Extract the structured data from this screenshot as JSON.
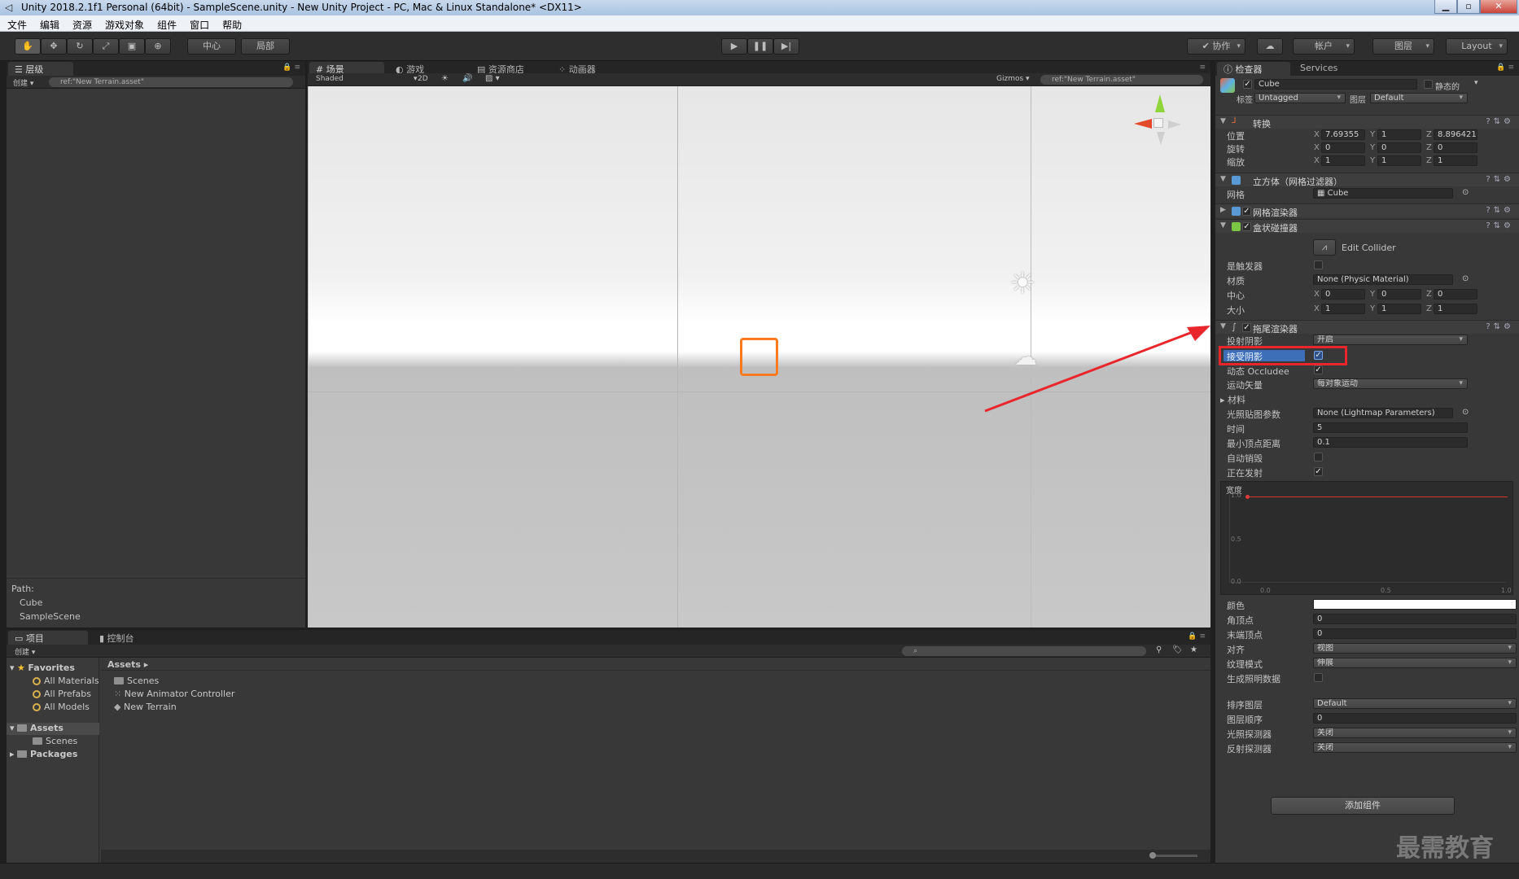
{
  "window": {
    "title": "Unity 2018.2.1f1 Personal (64bit) - SampleScene.unity - New Unity Project - PC, Mac & Linux Standalone* <DX11>"
  },
  "menu": [
    "文件",
    "编辑",
    "资源",
    "游戏对象",
    "组件",
    "窗口",
    "帮助"
  ],
  "toolbar": {
    "pivot": "中心",
    "local": "局部",
    "collab": "协作",
    "account": "帐户",
    "layers": "图层",
    "layout": "Layout"
  },
  "hierarchy": {
    "tab": "层级",
    "create": "创建",
    "search": "ref:\"New Terrain.asset\"",
    "path_label": "Path:",
    "path": [
      "Cube",
      "SampleScene"
    ]
  },
  "scene": {
    "tabs": [
      "场景",
      "游戏",
      "资源商店",
      "动画器"
    ],
    "shading": "Shaded",
    "mode2d": "2D",
    "gizmos": "Gizmos",
    "search": "ref:\"New Terrain.asset\""
  },
  "project": {
    "tabs": [
      "项目",
      "控制台"
    ],
    "create": "创建",
    "favorites": {
      "label": "Favorites",
      "items": [
        "All Materials",
        "All Prefabs",
        "All Models"
      ]
    },
    "assets_tree": {
      "label": "Assets",
      "children": [
        "Scenes"
      ]
    },
    "packages": "Packages",
    "breadcrumb": "Assets",
    "files": [
      "Scenes",
      "New Animator Controller",
      "New Terrain"
    ]
  },
  "inspector": {
    "tabs": [
      "检查器",
      "Services"
    ],
    "object_name": "Cube",
    "static_label": "静态的",
    "tag_label": "标签",
    "tag": "Untagged",
    "layer_label": "图层",
    "layer": "Default",
    "transform": {
      "title": "转换",
      "position_label": "位置",
      "position": [
        "7.69355",
        "1",
        "8.896421"
      ],
      "rotation_label": "旋转",
      "rotation": [
        "0",
        "0",
        "0"
      ],
      "scale_label": "缩放",
      "scale": [
        "1",
        "1",
        "1"
      ]
    },
    "meshfilter": {
      "title": "立方体（网格过滤器）",
      "mesh_label": "网格",
      "mesh": "Cube"
    },
    "meshrenderer": {
      "title": "网格渲染器"
    },
    "boxcollider": {
      "title": "盒状碰撞器",
      "edit": "Edit Collider",
      "trigger_label": "是触发器",
      "material_label": "材质",
      "material": "None (Physic Material)",
      "center_label": "中心",
      "center": [
        "0",
        "0",
        "0"
      ],
      "size_label": "大小",
      "size": [
        "1",
        "1",
        "1"
      ]
    },
    "trail": {
      "title": "拖尾渲染器",
      "cast_label": "投射阴影",
      "cast": "开启",
      "receive_label": "接受阴影",
      "occludee_label": "动态 Occludee",
      "motion_label": "运动矢量",
      "motion": "每对象运动",
      "materials_label": "材料",
      "lightmap_label": "光照贴图参数",
      "lightmap": "None (Lightmap Parameters)",
      "time_label": "时间",
      "time": "5",
      "minvertex_label": "最小顶点距离",
      "minvertex": "0.1",
      "autodestruct_label": "自动销毁",
      "emitting_label": "正在发射",
      "width_label": "宽度",
      "curve_y": [
        "1.0",
        "0.5",
        "0.0"
      ],
      "curve_x": [
        "0.0",
        "0.5",
        "1.0"
      ],
      "color_label": "颜色",
      "corner_label": "角顶点",
      "corner": "0",
      "endcap_label": "末端顶点",
      "endcap": "0",
      "align_label": "对齐",
      "align": "视图",
      "texture_label": "纹理模式",
      "texture": "伸展",
      "lighting_label": "生成照明数据",
      "sortlayer_label": "排序图层",
      "sortlayer": "Default",
      "order_label": "图层顺序",
      "order": "0",
      "probes_label": "光照探测器",
      "probes": "关闭",
      "reflection_label": "反射探测器",
      "reflection": "关闭"
    },
    "add_component": "添加组件"
  },
  "watermark": "最需教育",
  "colors": {
    "highlight": "#e8262c",
    "selection": "#ff7a1f",
    "accent": "#4f8ad8"
  }
}
